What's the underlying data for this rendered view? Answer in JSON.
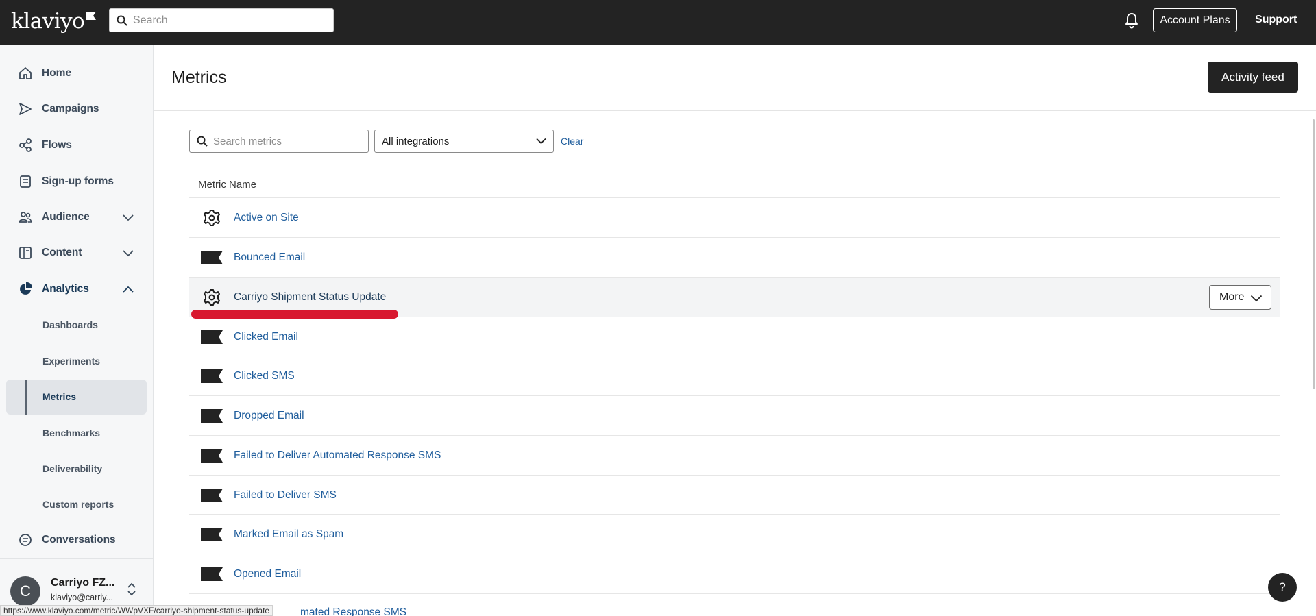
{
  "topbar": {
    "logo": "klaviyo",
    "search_placeholder": "Search",
    "account_plans_label": "Account Plans",
    "support_label": "Support"
  },
  "sidebar": {
    "items": [
      {
        "label": "Home",
        "icon": "home-icon"
      },
      {
        "label": "Campaigns",
        "icon": "send-icon"
      },
      {
        "label": "Flows",
        "icon": "flows-icon"
      },
      {
        "label": "Sign-up forms",
        "icon": "form-icon"
      },
      {
        "label": "Audience",
        "icon": "audience-icon",
        "expandable": true,
        "expanded": false
      },
      {
        "label": "Content",
        "icon": "content-icon",
        "expandable": true,
        "expanded": false
      },
      {
        "label": "Analytics",
        "icon": "analytics-icon",
        "expandable": true,
        "expanded": true
      },
      {
        "label": "Conversations",
        "icon": "chat-icon"
      }
    ],
    "analytics_sub": [
      "Dashboards",
      "Experiments",
      "Metrics",
      "Benchmarks",
      "Deliverability",
      "Custom reports"
    ],
    "active_sub": "Metrics",
    "account": {
      "initial": "C",
      "name": "Carriyo FZ...",
      "email": "klaviyo@carriy..."
    }
  },
  "main": {
    "title": "Metrics",
    "activity_feed_label": "Activity feed",
    "search_placeholder": "Search metrics",
    "integration_filter": "All integrations",
    "clear_label": "Clear",
    "column_header": "Metric Name",
    "more_label": "More",
    "rows": [
      {
        "label": "Active on Site",
        "icon": "gear-icon"
      },
      {
        "label": "Bounced Email",
        "icon": "klaviyo-flag-icon"
      },
      {
        "label": "Carriyo Shipment Status Update",
        "icon": "gear-icon",
        "hovered": true
      },
      {
        "label": "Clicked Email",
        "icon": "klaviyo-flag-icon"
      },
      {
        "label": "Clicked SMS",
        "icon": "klaviyo-flag-icon"
      },
      {
        "label": "Dropped Email",
        "icon": "klaviyo-flag-icon"
      },
      {
        "label": "Failed to Deliver Automated Response SMS",
        "icon": "klaviyo-flag-icon"
      },
      {
        "label": "Failed to Deliver SMS",
        "icon": "klaviyo-flag-icon"
      },
      {
        "label": "Marked Email as Spam",
        "icon": "klaviyo-flag-icon"
      },
      {
        "label": "Opened Email",
        "icon": "klaviyo-flag-icon"
      }
    ],
    "partial_row_label": "mated Response SMS"
  },
  "status_bar_url": "https://www.klaviyo.com/metric/WWpVXF/carriyo-shipment-status-update",
  "help_label": "?",
  "colors": {
    "topbar": "#232323",
    "link": "#1f5d9c",
    "annotation": "#d8182f"
  }
}
